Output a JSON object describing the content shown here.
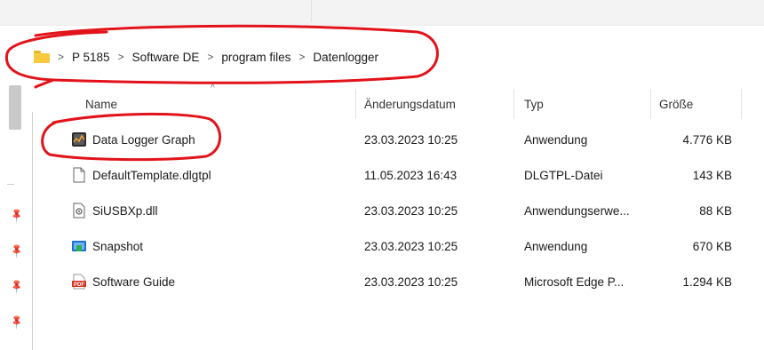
{
  "breadcrumb": {
    "segments": [
      "P 5185",
      "Software DE",
      "program files",
      "Datenlogger"
    ]
  },
  "columns": {
    "name": "Name",
    "date": "Änderungsdatum",
    "type": "Typ",
    "size": "Größe"
  },
  "files": [
    {
      "name": "Data Logger Graph",
      "date": "23.03.2023 10:25",
      "type": "Anwendung",
      "size": "4.776 KB",
      "icon": "app-graph-icon"
    },
    {
      "name": "DefaultTemplate.dlgtpl",
      "date": "11.05.2023 16:43",
      "type": "DLGTPL-Datei",
      "size": "143 KB",
      "icon": "document-icon"
    },
    {
      "name": "SiUSBXp.dll",
      "date": "23.03.2023 10:25",
      "type": "Anwendungserwe...",
      "size": "88 KB",
      "icon": "dll-icon"
    },
    {
      "name": "Snapshot",
      "date": "23.03.2023 10:25",
      "type": "Anwendung",
      "size": "670 KB",
      "icon": "snapshot-app-icon"
    },
    {
      "name": "Software Guide",
      "date": "23.03.2023 10:25",
      "type": "Microsoft Edge P...",
      "size": "1.294 KB",
      "icon": "pdf-icon"
    }
  ],
  "colors": {
    "annotation": "#e2131a",
    "folder": "#f8c93c",
    "pdf": "#d93025",
    "highlight_text": "#1a1a1a"
  }
}
